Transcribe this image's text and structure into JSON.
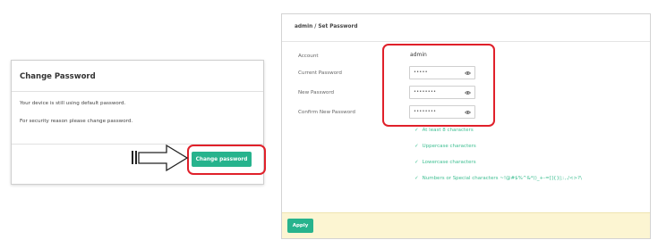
{
  "left_dialog": {
    "title": "Change Password",
    "message1": "Your device is still using default password.",
    "message2": "For security reason please change password.",
    "button_label": "Change password"
  },
  "right_panel": {
    "breadcrumb": "admin / Set Password",
    "account_label": "Account",
    "account_value": "admin",
    "current_password_label": "Current Password",
    "current_password_mask": "•••••",
    "new_password_label": "New Password",
    "new_password_mask": "••••••••",
    "confirm_password_label": "Confirm New Password",
    "confirm_password_mask": "••••••••",
    "rules": [
      "At least 8 characters",
      "Uppercase characters",
      "Lowercase characters",
      "Numbers or Special characters ~!@#$%^&*()_+-=[]{}|;:,./<>?\\"
    ],
    "check_symbol": "✓",
    "apply_label": "Apply"
  },
  "colors": {
    "accent": "#27b38d",
    "highlight": "#e0202a",
    "rule_text": "#3fbf92",
    "footer_bg": "#fcf5d2"
  }
}
